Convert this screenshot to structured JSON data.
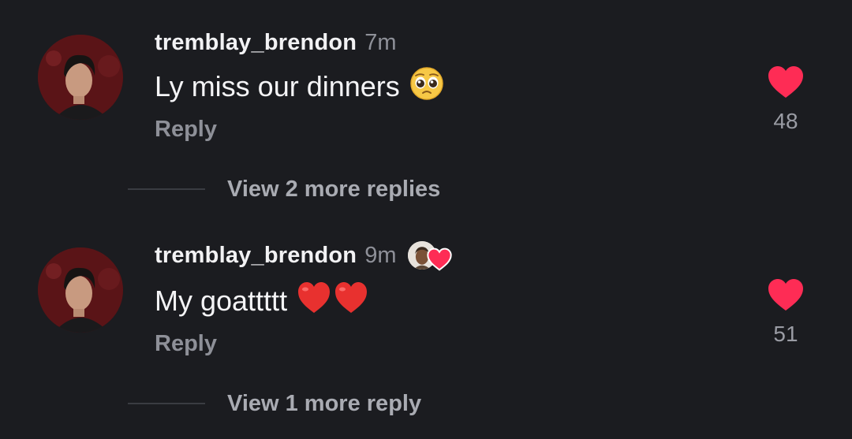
{
  "comments": [
    {
      "username": "tremblay_brendon",
      "time": "7m",
      "text": "Ly miss our dinners",
      "emoji": "pleading-face",
      "reply_label": "Reply",
      "likes": "48",
      "view_more": "View 2 more replies",
      "liked_by_creator": false
    },
    {
      "username": "tremblay_brendon",
      "time": "9m",
      "text": "My goattttt",
      "emoji": "red-heart-x2",
      "reply_label": "Reply",
      "likes": "51",
      "view_more": "View 1 more reply",
      "liked_by_creator": true
    }
  ],
  "colors": {
    "background": "#1b1c20",
    "heart": "#fe2c55",
    "muted_text": "#8e9098"
  }
}
